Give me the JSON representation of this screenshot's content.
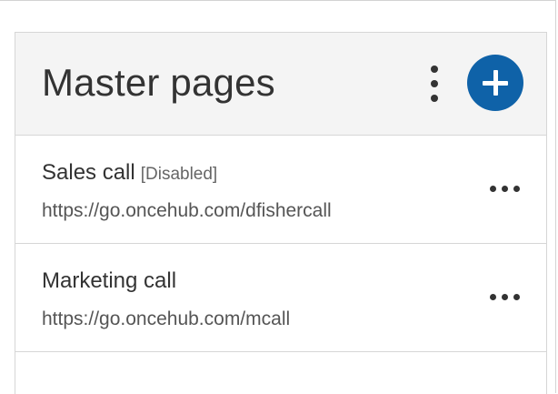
{
  "panel": {
    "title": "Master pages",
    "more_icon": "vertical-ellipsis-icon",
    "add_icon": "plus-icon",
    "accent_color": "#0f62a8"
  },
  "pages": [
    {
      "name": "Sales call",
      "status": "[Disabled]",
      "url": "https://go.oncehub.com/dfishercall",
      "more_icon": "horizontal-ellipsis-icon"
    },
    {
      "name": "Marketing call",
      "status": "",
      "url": "https://go.oncehub.com/mcall",
      "more_icon": "horizontal-ellipsis-icon"
    }
  ]
}
